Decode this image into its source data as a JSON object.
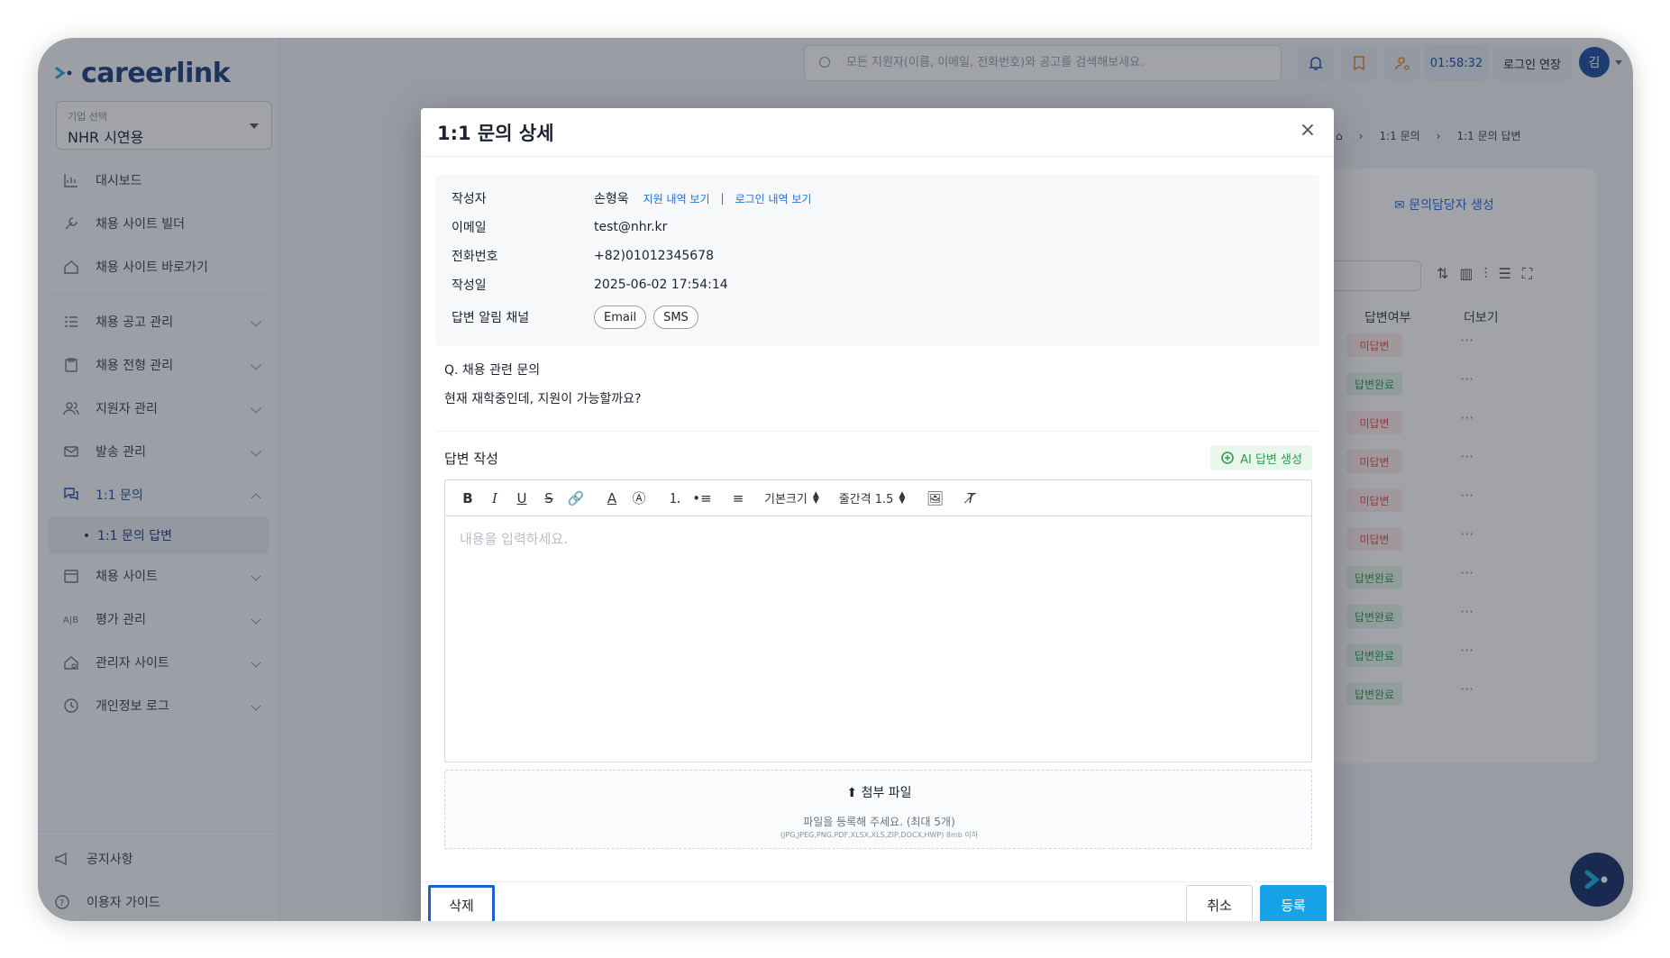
{
  "app": {
    "logo_text": "careerlink",
    "company_select": {
      "label": "기업 선택",
      "value": "NHR 시연용"
    },
    "header": {
      "search_placeholder": "모든 지원자(이름, 이메일, 전화번호)와 공고를 검색해보세요.",
      "timer": "01:58:32",
      "extend_label": "로그인 연장",
      "avatar_initial": "김"
    },
    "sidebar": {
      "items": [
        {
          "label": "대시보드",
          "icon": "chart-icon"
        },
        {
          "label": "채용 사이트 빌더",
          "icon": "tools-icon"
        },
        {
          "label": "채용 사이트 바로가기",
          "icon": "home-icon"
        },
        {
          "label": "채용 공고 관리",
          "icon": "list-icon"
        },
        {
          "label": "채용 전형 관리",
          "icon": "clipboard-icon"
        },
        {
          "label": "지원자 관리",
          "icon": "users-icon"
        },
        {
          "label": "발송 관리",
          "icon": "mail-icon"
        },
        {
          "label": "1:1 문의",
          "icon": "chat-icon"
        },
        {
          "label": "채용 사이트",
          "icon": "calendar-icon"
        },
        {
          "label": "평가 관리",
          "icon": "ab-icon"
        },
        {
          "label": "관리자 사이트",
          "icon": "admin-home-icon"
        },
        {
          "label": "개인정보 로그",
          "icon": "history-icon"
        }
      ],
      "sub_item": "1:1 문의 답변",
      "footer": [
        {
          "label": "공지사항",
          "icon": "megaphone-icon"
        },
        {
          "label": "이용자 가이드",
          "icon": "help-icon"
        }
      ]
    },
    "breadcrumb": [
      "1:1 문의",
      "1:1 문의 답변"
    ],
    "create_manager_label": "문의담당자 생성",
    "table": {
      "columns": [
        "답변여부",
        "더보기"
      ],
      "rows": [
        "미답변",
        "답변완료",
        "미답변",
        "미답변",
        "미답변",
        "미답변",
        "답변완료",
        "답변완료",
        "답변완료",
        "답변완료"
      ],
      "more_label": "···"
    }
  },
  "modal": {
    "title": "1:1 문의 상세",
    "close_label": "×",
    "info": {
      "author_label": "작성자",
      "author_value": "손형욱",
      "apply_history_link": "지원 내역 보기",
      "link_separator": "|",
      "login_history_link": "로그인 내역 보기",
      "email_label": "이메일",
      "email_value": "test@nhr.kr",
      "phone_label": "전화번호",
      "phone_value": "+82)01012345678",
      "date_label": "작성일",
      "date_value": "2025-06-02 17:54:14",
      "channel_label": "답변 알림 채널",
      "channels": [
        "Email",
        "SMS"
      ]
    },
    "question": {
      "title": "Q. 채용 관련 문의",
      "body": "현재 재학중인데, 지원이 가능할까요?"
    },
    "answer": {
      "label": "답변 작성",
      "ai_button": "AI 답변 생성",
      "size_select": "기본크기",
      "line_spacing_select": "줄간격 1.5",
      "placeholder": "내용을 입력하세요."
    },
    "upload": {
      "title": "첨부 파일",
      "hint": "파일을 등록해 주세요. (최대 5개)",
      "types": "(JPG,JPEG,PNG,PDF,XLSX,XLS,ZIP,DOCX,HWP) 8mb 이하"
    },
    "buttons": {
      "delete": "삭제",
      "cancel": "취소",
      "submit": "등록"
    }
  }
}
